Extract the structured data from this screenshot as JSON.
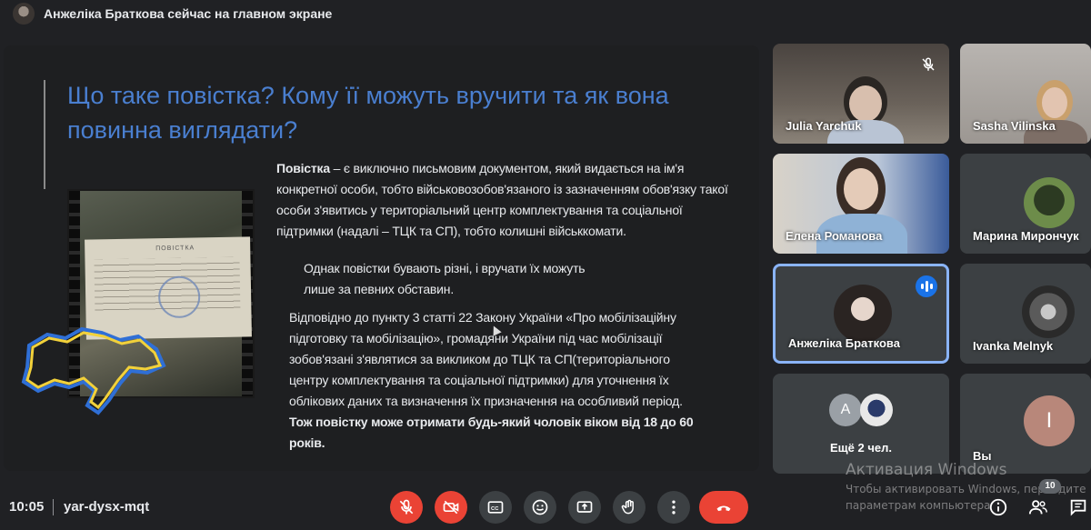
{
  "topbar": {
    "presenter_text": "Анжеліка Браткова сейчас на главном экране"
  },
  "slide": {
    "title": "Що таке повістка? Кому її можуть вручити та як вона повинна виглядати?",
    "photo_doc_title": "ПОВІСТКА",
    "para1_bold": "Повістка",
    "para1_rest": " – є виключно письмовим документом, який видається на ім'я конкретної особи, тобто військовозобов'язаного із зазначенням обов'язку такої особи з'явитись у територіальний центр комплектування та соціальної підтримки (надалі – ТЦК та СП), тобто колишні військкомати.",
    "para2": "Однак повістки бувають різні, і вручати їх можуть лише за певних обставин.",
    "para3": "Відповідно до пункту 3 статті 22 Закону України «Про мобілізаційну підготовку та мобілізацію», громадяни України під час мобілізації зобов'язані з'являтися за викликом до ТЦК та СП(територіального центру комплектування та соціальної підтримки) для уточнення їх облікових даних та визначення їх призначення на особливий період.",
    "para3_bold": "Тож повістку може отримати будь-який чоловік віком від 18 до 60 років.",
    "colors": {
      "title": "#4a7fd0",
      "map_blue": "#2f6fd6",
      "map_yellow": "#f2d13a"
    }
  },
  "participants": [
    {
      "name": "Julia Yarchuk",
      "muted": true
    },
    {
      "name": "Sasha Vilinska"
    },
    {
      "name": "Елена Романова"
    },
    {
      "name": "Марина Мирончук"
    },
    {
      "name": "Анжеліка Браткова",
      "speaking": true
    },
    {
      "name": "Ivanka Melnyk"
    },
    {
      "name": "Ещё 2 чел.",
      "avatar_letter": "A"
    },
    {
      "name": "Вы",
      "avatar_letter": "I"
    }
  ],
  "bottombar": {
    "time": "10:05",
    "meeting_code": "yar-dysx-mqt",
    "controls": [
      "mic-off",
      "camera-off",
      "captions",
      "reactions",
      "present-now",
      "raise-hand",
      "more-options",
      "leave-call"
    ],
    "right_controls": [
      "info",
      "people",
      "chat"
    ],
    "people_count": "10"
  },
  "watermark": {
    "title": "Активация Windows",
    "line1": "Чтобы активировать Windows, перейдите",
    "line2": "параметрам компьютера"
  },
  "accent_colors": {
    "red": "#ea4335",
    "blue": "#1a73e8",
    "speaking_border": "#8ab4f8"
  }
}
